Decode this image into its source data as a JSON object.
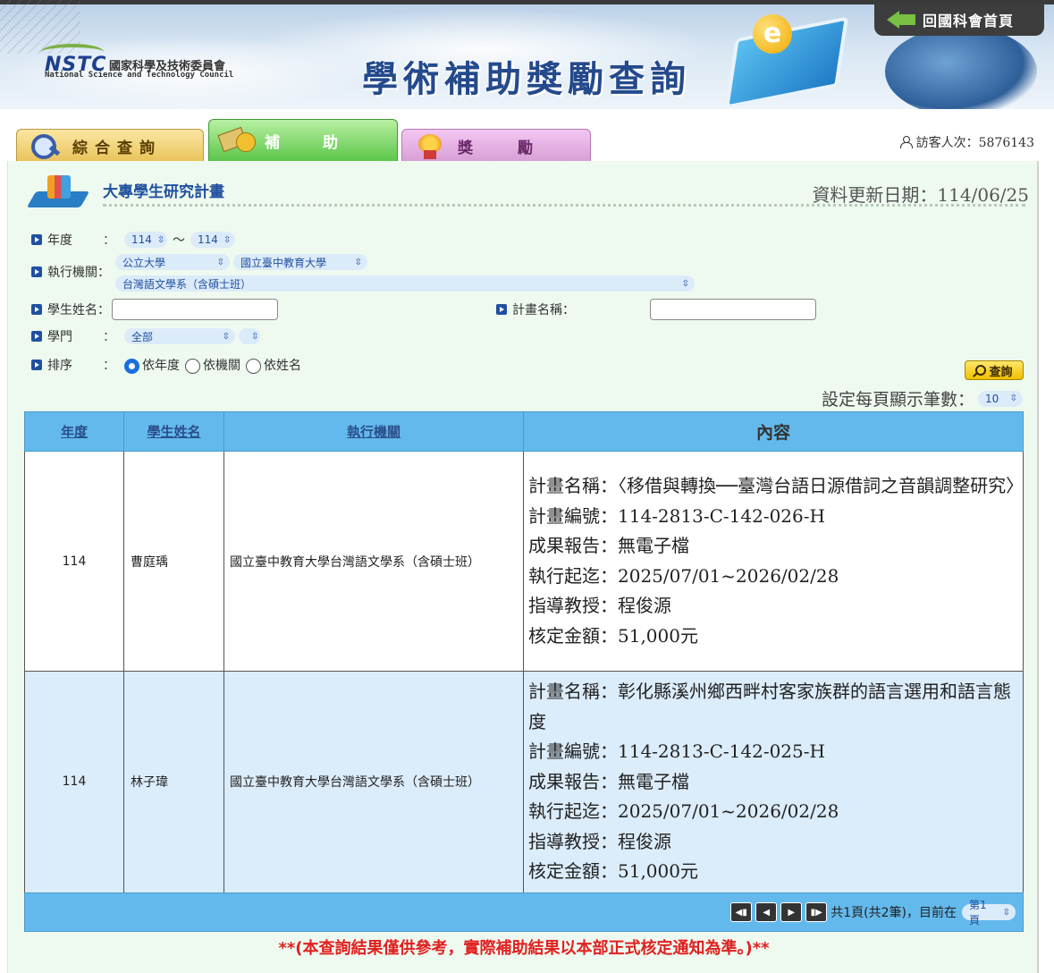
{
  "header": {
    "logo_abbr": "NSTC",
    "logo_cn": "國家科學及技術委員會",
    "logo_en": "National Science and Technology Council",
    "site_title": "學術補助獎勵查詢",
    "home_link": "回國科會首頁"
  },
  "tabs": [
    {
      "label": "綜合查詢",
      "icon": "magnifier-icon",
      "color": "#e9c35a"
    },
    {
      "label": "補助",
      "icon": "money-icon",
      "color": "#5cc64a"
    },
    {
      "label": "獎勵",
      "icon": "medal-icon",
      "color": "#d79ed4"
    }
  ],
  "visitor": {
    "text": "訪客人次：5876143"
  },
  "section": {
    "title": "大專學生研究計畫",
    "update_date": "資料更新日期：114/06/25"
  },
  "filters": {
    "year_label": "年度",
    "year_from": "114",
    "year_sep": "〜",
    "year_to": "114",
    "inst_label": "執行機關：",
    "inst_type": "公立大學",
    "inst_name": "國立臺中教育大學",
    "inst_dept": "台灣語文學系（含碩士班）",
    "student_label": "學生姓名：",
    "student_value": "",
    "plan_label": "計畫名稱：",
    "plan_value": "",
    "field_label": "學門",
    "field_value": "全部",
    "field_sub": "",
    "sort_label": "排序",
    "sort_options": [
      "依年度",
      "依機關",
      "依姓名"
    ],
    "sort_selected": "依年度",
    "query_button": "查詢",
    "colon": "：",
    "pagesize_label": "設定每頁顯示筆數：",
    "pagesize_value": "10"
  },
  "table": {
    "headers": [
      "年度",
      "學生姓名",
      "執行機關",
      "內容"
    ],
    "rows": [
      {
        "year": "114",
        "name": "曹庭瑀",
        "institution": "國立臺中教育大學台灣語文學系（含碩士班）",
        "plan_name": "計畫名稱：〈移借與轉換──臺灣台語日源借詞之音韻調整研究〉",
        "plan_no": "計畫編號：114-2813-C-142-026-H",
        "report": "成果報告：無電子檔",
        "period": "執行起迄：2025/07/01~2026/02/28",
        "advisor": "指導教授：程俊源",
        "amount": "核定金額：51,000元"
      },
      {
        "year": "114",
        "name": "林子瑋",
        "institution": "國立臺中教育大學台灣語文學系（含碩士班）",
        "plan_name": "計畫名稱：彰化縣溪州鄉西畔村客家族群的語言選用和語言態度",
        "plan_no": "計畫編號：114-2813-C-142-025-H",
        "report": "成果報告：無電子檔",
        "period": "執行起迄：2025/07/01~2026/02/28",
        "advisor": "指導教授：程俊源",
        "amount": "核定金額：51,000元"
      }
    ]
  },
  "pager": {
    "summary": "共1頁(共2筆)，目前在",
    "current": "第1頁"
  },
  "disclaimer": "**(本查詢結果僅供參考，實際補助結果以本部正式核定通知為準。)**",
  "colors": {
    "accent_blue": "#1f4fa0",
    "table_header": "#63b9ec",
    "panel_bg": "#eefaef",
    "disclaimer_red": "#e02020"
  }
}
